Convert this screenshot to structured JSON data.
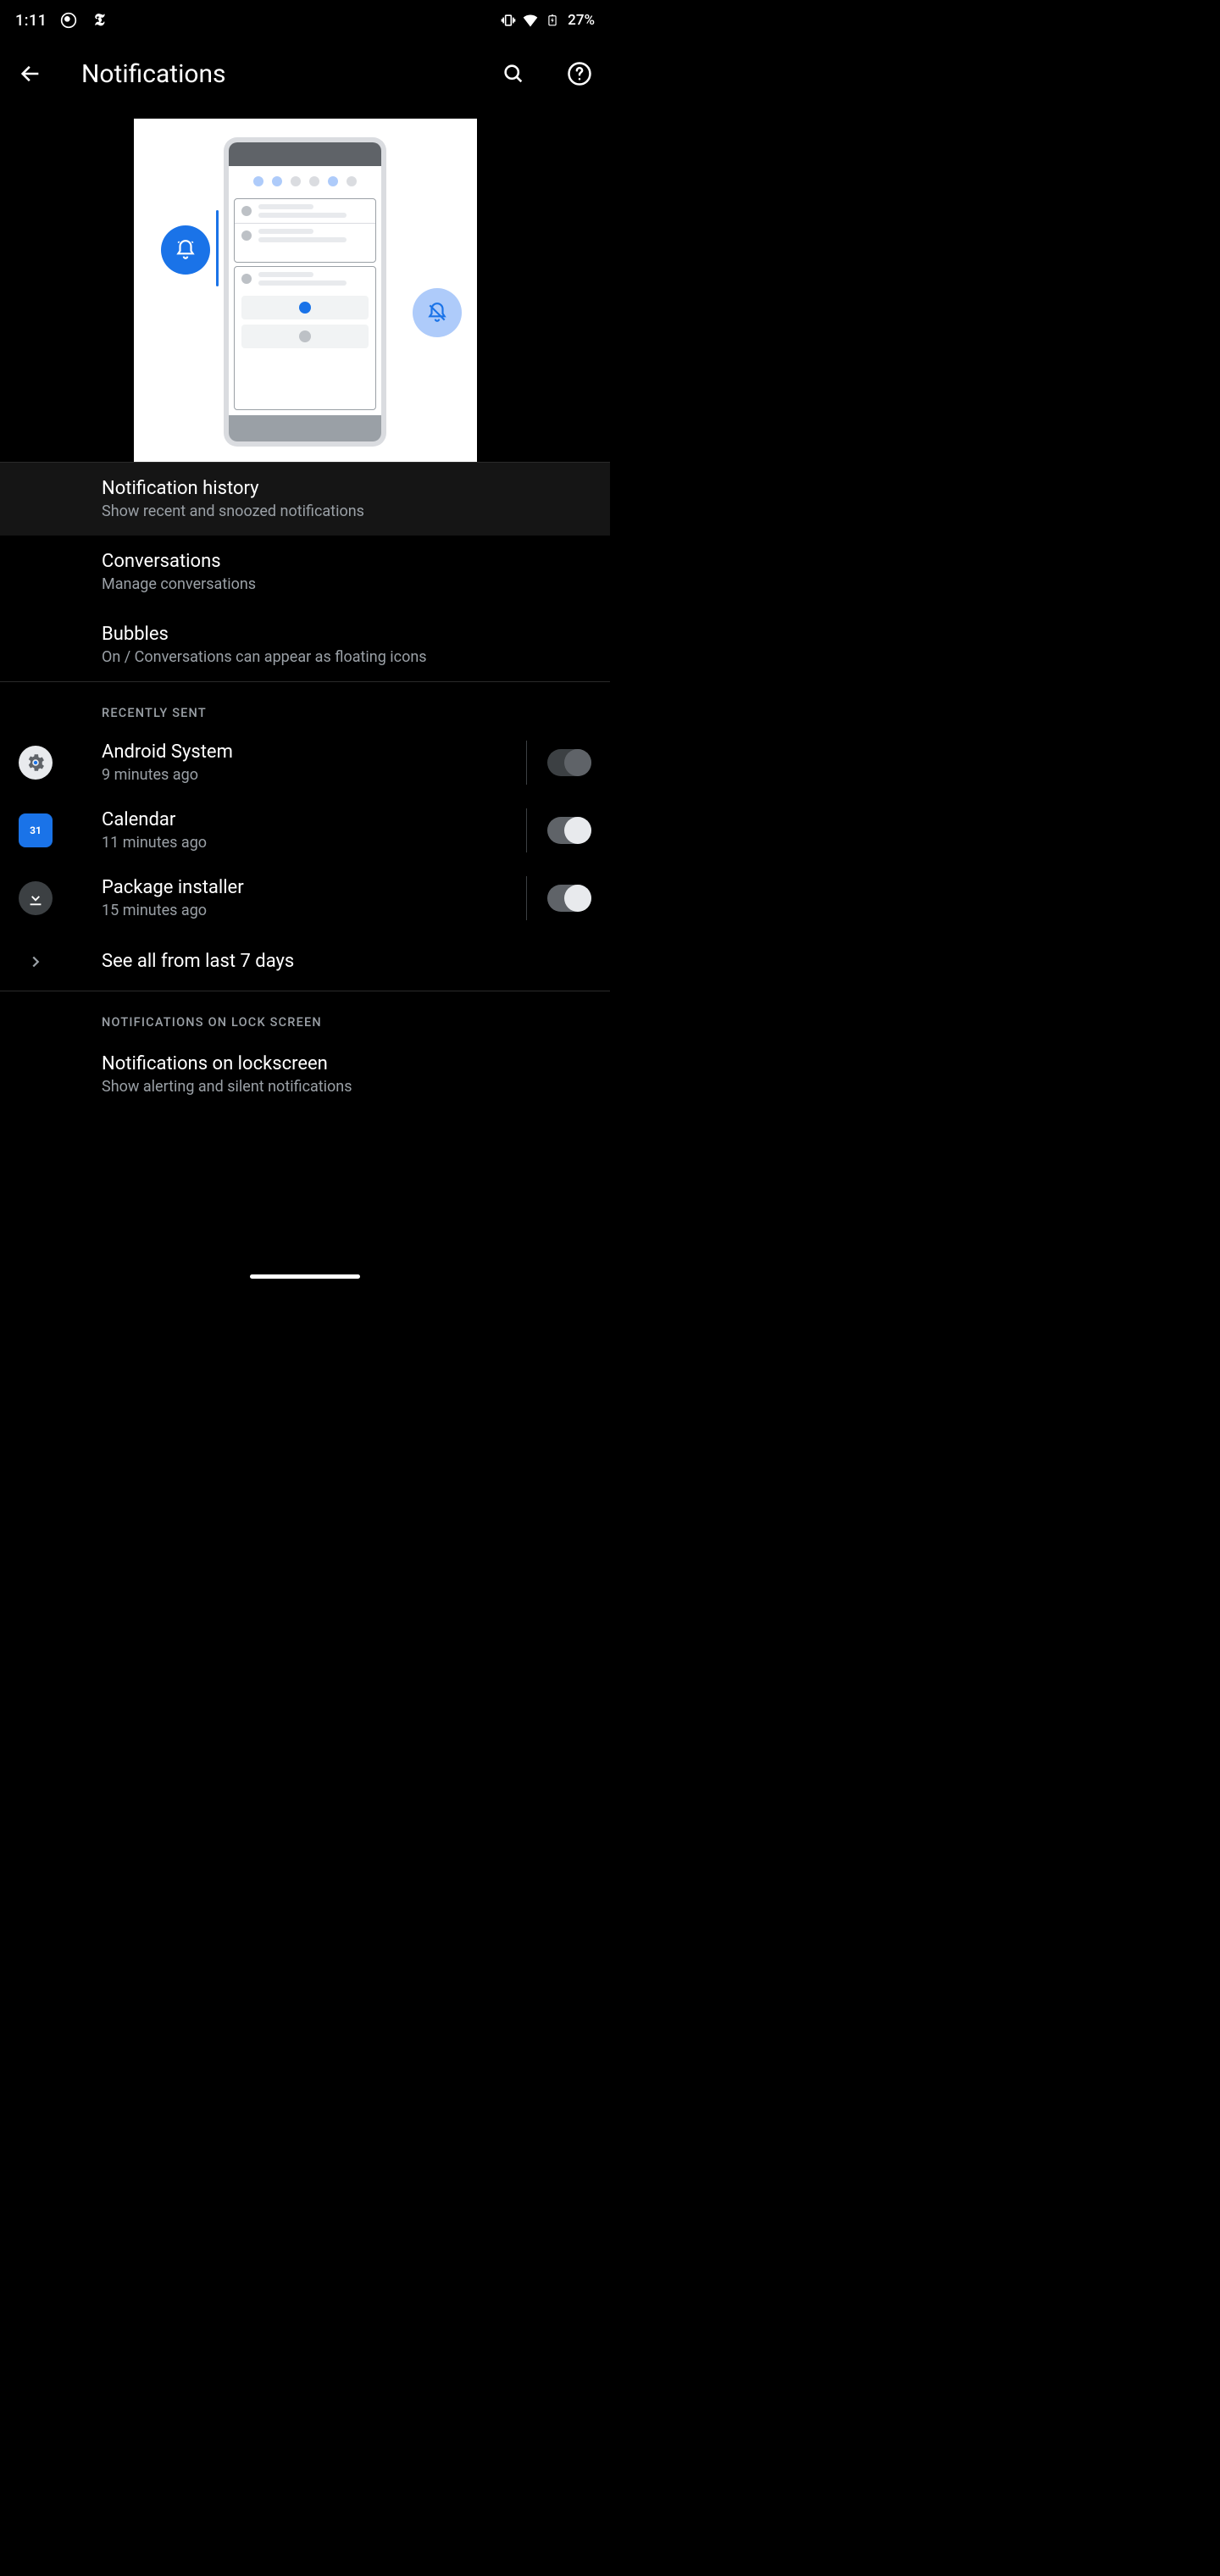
{
  "status": {
    "time": "1:11",
    "battery_pct": "27%"
  },
  "header": {
    "title": "Notifications"
  },
  "items": {
    "history": {
      "title": "Notification history",
      "sub": "Show recent and snoozed notifications"
    },
    "conversations": {
      "title": "Conversations",
      "sub": "Manage conversations"
    },
    "bubbles": {
      "title": "Bubbles",
      "sub": "On / Conversations can appear as floating icons"
    },
    "lockscreen": {
      "title": "Notifications on lockscreen",
      "sub": "Show alerting and silent notifications"
    }
  },
  "sections": {
    "recent": "RECENTLY SENT",
    "lock": "NOTIFICATIONS ON LOCK SCREEN"
  },
  "recent": [
    {
      "name": "Android System",
      "time": "9 minutes ago",
      "icon": "settings",
      "enabled": false
    },
    {
      "name": "Calendar",
      "time": "11 minutes ago",
      "icon": "calendar",
      "enabled": true,
      "badge": "31"
    },
    {
      "name": "Package installer",
      "time": "15 minutes ago",
      "icon": "download",
      "enabled": true
    }
  ],
  "see_all": "See all from last 7 days"
}
